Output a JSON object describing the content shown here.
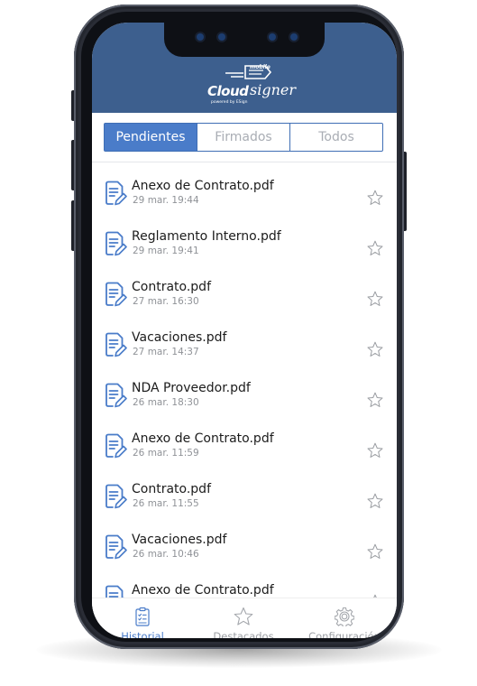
{
  "app": {
    "brand": "Cloud",
    "brand_script": "signer",
    "brand_tag": "mobile",
    "brand_powered": "powered by ESign"
  },
  "segments": [
    {
      "label": "Pendientes",
      "active": true
    },
    {
      "label": "Firmados",
      "active": false
    },
    {
      "label": "Todos",
      "active": false
    }
  ],
  "documents": [
    {
      "name": "Anexo de Contrato.pdf",
      "date": "29 mar. 19:44",
      "icon": "document-sign-icon",
      "star": "star-outline-icon"
    },
    {
      "name": "Reglamento Interno.pdf",
      "date": "29 mar. 19:41",
      "icon": "document-sign-icon",
      "star": "star-outline-icon"
    },
    {
      "name": "Contrato.pdf",
      "date": "27 mar. 16:30",
      "icon": "document-sign-icon",
      "star": "star-outline-icon"
    },
    {
      "name": "Vacaciones.pdf",
      "date": "27 mar. 14:37",
      "icon": "document-sign-icon",
      "star": "star-outline-icon"
    },
    {
      "name": "NDA Proveedor.pdf",
      "date": "26 mar. 18:30",
      "icon": "document-sign-icon",
      "star": "star-outline-icon"
    },
    {
      "name": "Anexo de Contrato.pdf",
      "date": "26 mar. 11:59",
      "icon": "document-sign-icon",
      "star": "star-outline-icon"
    },
    {
      "name": "Contrato.pdf",
      "date": "26 mar. 11:55",
      "icon": "document-sign-icon",
      "star": "star-outline-icon"
    },
    {
      "name": "Vacaciones.pdf",
      "date": "26 mar. 10:46",
      "icon": "document-sign-icon",
      "star": "star-outline-icon"
    },
    {
      "name": "Anexo de Contrato.pdf",
      "date": "",
      "icon": "document-sign-icon",
      "star": "star-outline-icon"
    }
  ],
  "tabs": [
    {
      "label": "Historial",
      "icon": "clipboard-checklist-icon",
      "active": true
    },
    {
      "label": "Destacados",
      "icon": "star-outline-icon",
      "active": false
    },
    {
      "label": "Configuración",
      "icon": "gear-icon",
      "active": false
    }
  ],
  "colors": {
    "header": "#3d5f8e",
    "accent": "#4a7cc9",
    "text": "#1c1c1c",
    "muted": "#8f9297"
  }
}
